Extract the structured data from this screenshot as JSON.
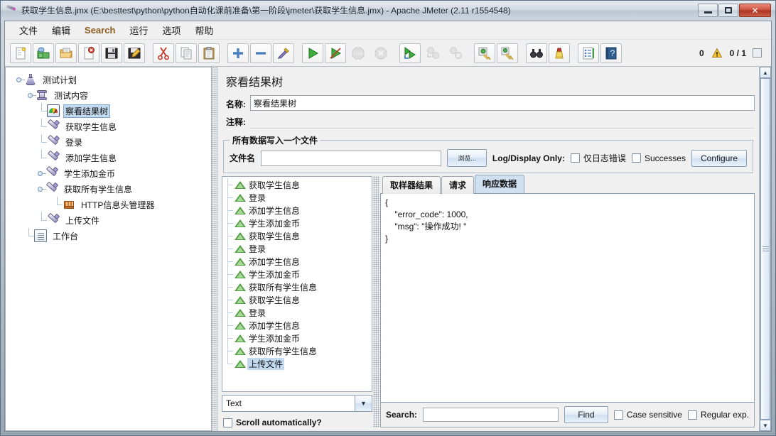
{
  "window": {
    "title": "获取学生信息.jmx (E:\\besttest\\python\\python自动化课前准备\\第一阶段\\jmeter\\获取学生信息.jmx) - Apache JMeter (2.11 r1554548)",
    "icon": "jmeter-feather-icon",
    "minimize_label": "—",
    "maximize_label": "▣",
    "close_label": "✕"
  },
  "menubar": {
    "items": [
      {
        "label": "文件"
      },
      {
        "label": "编辑"
      },
      {
        "label": "Search"
      },
      {
        "label": "运行"
      },
      {
        "label": "选项"
      },
      {
        "label": "帮助"
      }
    ]
  },
  "toolbar": {
    "buttons": [
      {
        "name": "new-icon"
      },
      {
        "name": "templates-icon"
      },
      {
        "name": "open-icon"
      },
      {
        "name": "close-icon"
      },
      {
        "name": "save-icon"
      },
      {
        "name": "save-as-icon"
      },
      {
        "name": "cut-icon"
      },
      {
        "name": "copy-icon"
      },
      {
        "name": "paste-icon"
      },
      {
        "name": "expand-all-icon"
      },
      {
        "name": "collapse-all-icon"
      },
      {
        "name": "toggle-icon"
      },
      {
        "name": "start-icon"
      },
      {
        "name": "start-no-pauses-icon"
      },
      {
        "name": "stop-icon"
      },
      {
        "name": "shutdown-icon"
      },
      {
        "name": "start-remote-all-icon"
      },
      {
        "name": "stop-remote-all-icon"
      },
      {
        "name": "shutdown-remote-all-icon"
      },
      {
        "name": "clear-icon"
      },
      {
        "name": "clear-all-icon"
      },
      {
        "name": "search-icon"
      },
      {
        "name": "search-reset-icon"
      },
      {
        "name": "function-helper-icon"
      },
      {
        "name": "help-icon"
      }
    ],
    "warning_count": "0",
    "warning_icon": "warning-triangle-icon",
    "thread_counter": "0 / 1"
  },
  "tree": {
    "nodes": [
      {
        "label": "测试计划",
        "icon": "test-plan-icon",
        "depth": 0,
        "expanded": true,
        "selected": false
      },
      {
        "label": "测试内容",
        "icon": "thread-group-icon",
        "depth": 1,
        "expanded": true,
        "selected": false
      },
      {
        "label": "察看结果树",
        "icon": "view-results-tree-icon",
        "depth": 2,
        "expanded": null,
        "selected": true
      },
      {
        "label": "获取学生信息",
        "icon": "http-sampler-icon",
        "depth": 2,
        "expanded": null,
        "selected": false
      },
      {
        "label": "登录",
        "icon": "http-sampler-icon",
        "depth": 2,
        "expanded": null,
        "selected": false
      },
      {
        "label": "添加学生信息",
        "icon": "http-sampler-icon",
        "depth": 2,
        "expanded": null,
        "selected": false
      },
      {
        "label": "学生添加金币",
        "icon": "http-sampler-icon",
        "depth": 2,
        "expanded": false,
        "selected": false
      },
      {
        "label": "获取所有学生信息",
        "icon": "http-sampler-icon",
        "depth": 2,
        "expanded": true,
        "selected": false
      },
      {
        "label": "HTTP信息头管理器",
        "icon": "header-manager-icon",
        "depth": 3,
        "expanded": null,
        "selected": false
      },
      {
        "label": "上传文件",
        "icon": "http-sampler-icon",
        "depth": 2,
        "expanded": null,
        "selected": false
      },
      {
        "label": "工作台",
        "icon": "workbench-icon",
        "depth": 0,
        "expanded": null,
        "selected": false
      }
    ]
  },
  "panel": {
    "title": "察看结果树",
    "name_label": "名称:",
    "name_value": "察看结果树",
    "comment_label": "注释:",
    "comment_value": "",
    "filegroup": {
      "legend": "所有数据写入一个文件",
      "filename_label": "文件名",
      "filename_value": "",
      "browse_label": "浏览...",
      "log_display_only_label": "Log/Display Only:",
      "errors_only_label": "仅日志错误",
      "successes_label": "Successes",
      "configure_label": "Configure"
    }
  },
  "results": {
    "items": [
      {
        "label": "获取学生信息",
        "selected": false
      },
      {
        "label": "登录",
        "selected": false
      },
      {
        "label": "添加学生信息",
        "selected": false
      },
      {
        "label": "学生添加金币",
        "selected": false
      },
      {
        "label": "获取学生信息",
        "selected": false
      },
      {
        "label": "登录",
        "selected": false
      },
      {
        "label": "添加学生信息",
        "selected": false
      },
      {
        "label": "学生添加金币",
        "selected": false
      },
      {
        "label": "获取所有学生信息",
        "selected": false
      },
      {
        "label": "获取学生信息",
        "selected": false
      },
      {
        "label": "登录",
        "selected": false
      },
      {
        "label": "添加学生信息",
        "selected": false
      },
      {
        "label": "学生添加金币",
        "selected": false
      },
      {
        "label": "获取所有学生信息",
        "selected": false
      },
      {
        "label": "上传文件",
        "selected": true
      }
    ],
    "renderer_value": "Text",
    "scroll_auto_label": "Scroll automatically?"
  },
  "tabs": [
    {
      "label": "取样器结果",
      "active": false
    },
    {
      "label": "请求",
      "active": false
    },
    {
      "label": "响应数据",
      "active": true
    }
  ],
  "response": {
    "body": "{\n    \"error_code\": 1000,\n    \"msg\": \"操作成功! \"\n}"
  },
  "search": {
    "label": "Search:",
    "value": "",
    "find_label": "Find",
    "case_sensitive_label": "Case sensitive",
    "regular_exp_label": "Regular exp."
  },
  "colors": {
    "selection": "#c3d9ef",
    "accent_menu": "#8a5a20",
    "close_button": "#cf5340",
    "active_tab": "#cfe0f1",
    "sampler_ok": "#4f9e3f"
  }
}
